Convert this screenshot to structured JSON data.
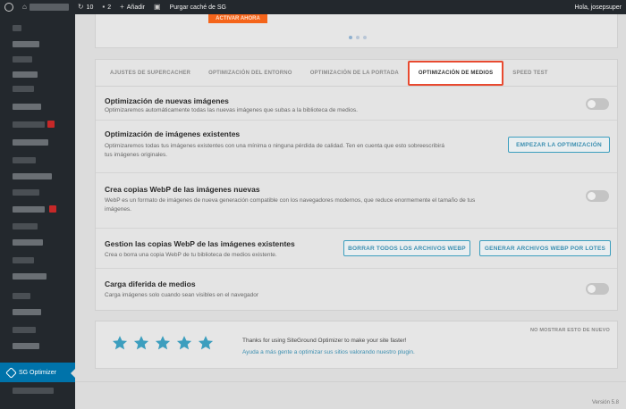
{
  "adminbar": {
    "updates_count": "10",
    "comments_count": "2",
    "add_new_label": "Añadir",
    "purge_label": "Purgar caché de SG",
    "greeting": "Hola, josepsuper"
  },
  "sidebar": {
    "active_item_label": "SG Optimizer"
  },
  "banner": {
    "activate_button": "ACTIVAR AHORA"
  },
  "tabs": [
    {
      "label": "AJUSTES DE SUPERCACHER",
      "active": false
    },
    {
      "label": "OPTIMIZACIÓN DEL ENTORNO",
      "active": false
    },
    {
      "label": "OPTIMIZACIÓN DE LA PORTADA",
      "active": false
    },
    {
      "label": "OPTIMIZACIÓN DE MEDIOS",
      "active": true
    },
    {
      "label": "SPEED TEST",
      "active": false
    }
  ],
  "settings": [
    {
      "title": "Optimización de nuevas imágenes",
      "description": "Optimizaremos automáticamente todas las nuevas imágenes que subas a la biblioteca de medios.",
      "toggle_on": false
    },
    {
      "title": "Optimización de imágenes existentes",
      "description_line1": "Optimizaremos todas tus imágenes existentes con una mínima o ninguna pérdida de calidad. Ten en cuenta que esto sobreescribirá",
      "description_line2": "tus imágenes originales.",
      "button": "EMPEZAR LA OPTIMIZACIÓN"
    },
    {
      "title": "Crea copias WebP de las imágenes nuevas",
      "description_line1": "WebP es un formato de imágenes de nueva generación compatible con los navegadores modernos, que reduce enormemente el tamaño de tus",
      "description_line2": "imágenes.",
      "toggle_on": false
    },
    {
      "title": "Gestion las copias WebP de las imágenes existentes",
      "description": "Crea o borra una copia WebP de tu biblioteca de medios existente.",
      "button_delete": "BORRAR TODOS LOS ARCHIVOS WEBP",
      "button_generate": "GENERAR ARCHIVOS WEBP POR LOTES"
    },
    {
      "title": "Carga diferida de medios",
      "description": "Carga imágenes solo cuando sean visibles en el navegador",
      "toggle_on": false
    }
  ],
  "rating": {
    "stars": 5,
    "thanks_text": "Thanks for using SiteGround Optimizer to make your site faster!",
    "link_text": "Ayuda a más gente a optimizar sus sitios valorando nuestro plugin.",
    "dismiss": "NO MOSTRAR ESTO DE NUEVO",
    "star_color": "#3c9ebe"
  },
  "footer": {
    "version": "Versión 5.8"
  },
  "colors": {
    "accent_tab_border": "#e84a30",
    "button_blue": "#3c9ebe",
    "sidebar_active": "#0073aa"
  }
}
